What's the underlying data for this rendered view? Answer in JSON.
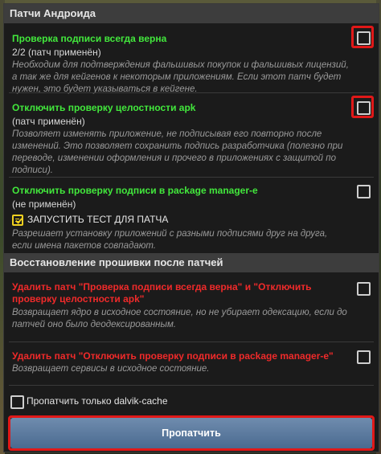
{
  "sections": {
    "android_patches": "Патчи Андроида",
    "firmware_restore": "Восстановление прошивки после патчей"
  },
  "items": [
    {
      "title": "Проверка подписи всегда верна",
      "status": "2/2 (патч применён)",
      "description": "Необходим для подтверждения фальшивых покупок и фальшивых лицензий, а так же для кейгенов к некоторым приложениям. Если этот патч будет нужен, это будет указываться в кейгене.",
      "checked": false,
      "highlighted": true
    },
    {
      "title": "Отключить проверку целостности apk",
      "status": "(патч применён)",
      "description": "Позволяет изменять приложение, не подписывая его повторно после изменений. Это позволяет сохранить подпись разработчика (полезно при переводе, изменении оформления и прочего в приложениях с защитой по подписи).",
      "checked": false,
      "highlighted": true
    },
    {
      "title": "Отключить проверку подписи в package manager-e",
      "status": "(не применён)",
      "test_button": "ЗАПУСТИТЬ ТЕСТ ДЛЯ ПАТЧА",
      "description": "Разрешает установку приложений с разными подписями друг на друга, если имена пакетов совпадают.",
      "checked": false,
      "highlighted": false
    },
    {
      "title": "Удалить патч \"Проверка подписи всегда верна\" и \"Отключить проверку целостности apk\"",
      "description": "Возвращает ядро в исходное состояние, но не убирает одексацию, если до патчей оно было деодексированным.",
      "checked": false
    },
    {
      "title": "Удалить патч \"Отключить проверку подписи в package manager-e\"",
      "description": "Возвращает сервисы в исходное состояние.",
      "checked": false
    }
  ],
  "dalvik_option": {
    "label": "Пропатчить только dalvik-cache",
    "checked": false
  },
  "patch_button": "Пропатчить",
  "colors": {
    "enable_title": "#42e83c",
    "remove_title": "#f02a2a",
    "highlight": "#e01818",
    "button": "#5a7a9f"
  }
}
